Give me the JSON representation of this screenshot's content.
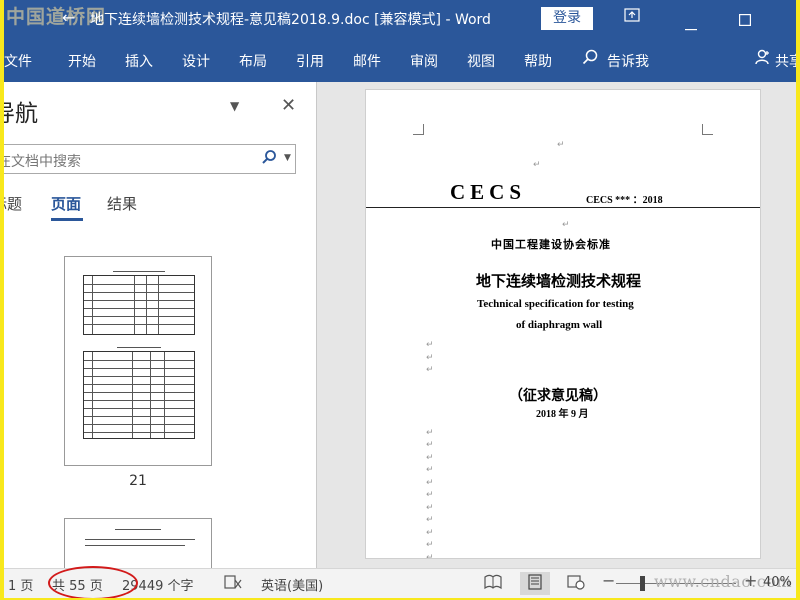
{
  "titlebar": {
    "watermark": "中国道桥网",
    "doc_title": "地下连续墙检测技术规程-意见稿2018.9.doc [兼容模式]  -  Word",
    "login_label": "登录",
    "icons": [
      "back-arrow-icon",
      "ribbon-display-icon",
      "minimize-icon",
      "maximize-icon"
    ]
  },
  "ribbon": {
    "tabs": [
      "文件",
      "开始",
      "插入",
      "设计",
      "布局",
      "引用",
      "邮件",
      "审阅",
      "视图",
      "帮助"
    ],
    "tell_me": "告诉我",
    "share": "共享"
  },
  "nav": {
    "title": "导航",
    "search_placeholder": "在文档中搜索",
    "tabs": [
      "标题",
      "页面",
      "结果"
    ],
    "active_tab": "页面",
    "thumbnail_page": "21"
  },
  "page": {
    "cecs": "CECS",
    "cecs_code": "CECS *** ：2018",
    "association": "中国工程建设协会标准",
    "title_cn": "地下连续墙检测技术规程",
    "title_en_1": "Technical specification for testing",
    "title_en_2": "of diaphragm wall",
    "draft": "（征求意见稿）",
    "date": "2018 年 9 月",
    "para_mark": "↵"
  },
  "status": {
    "page_current": "1 页",
    "page_total": "共 55 页",
    "word_count": "29449 个字",
    "language": "英语(美国)",
    "zoom": "40%",
    "site_watermark": "www.cndao.com"
  },
  "colors": {
    "word_blue": "#2b579a",
    "highlight_ellipse": "#d21a1a",
    "frame_yellow": "#f8e81c"
  }
}
